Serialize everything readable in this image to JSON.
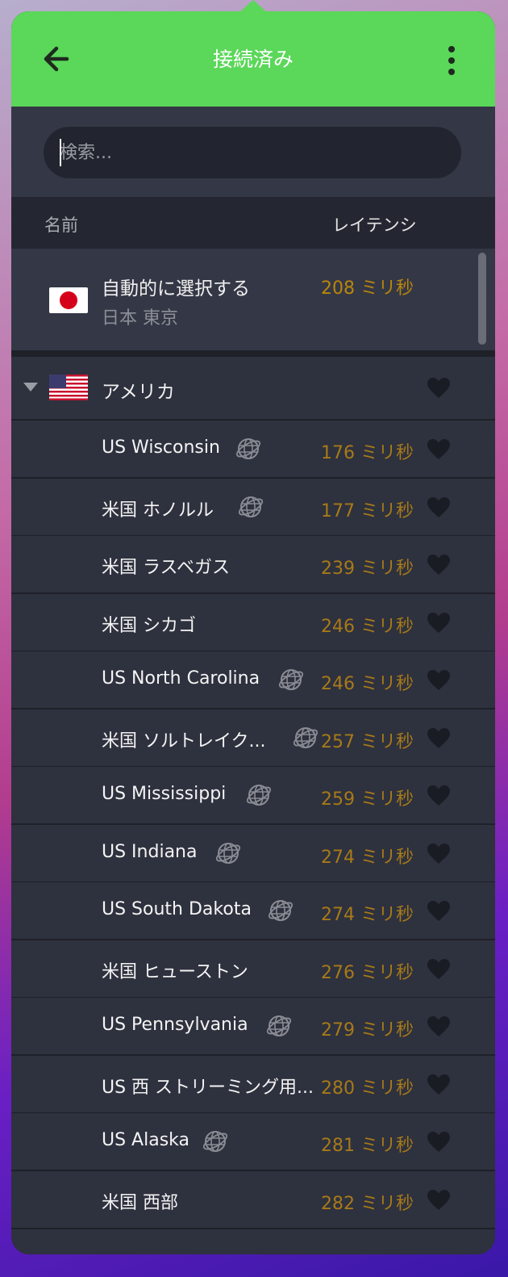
{
  "header": {
    "title": "接続済み"
  },
  "search": {
    "placeholder": "検索..."
  },
  "columns": {
    "name": "名前",
    "latency": "レイテンシ"
  },
  "auto": {
    "title": "自動的に選択する",
    "subtitle": "日本 東京",
    "latency": "208 ミリ秒"
  },
  "country": {
    "name": "アメリカ"
  },
  "servers": [
    {
      "name": "US Wisconsin",
      "latency": "176 ミリ秒"
    },
    {
      "name": "米国 ホノルル",
      "latency": "177 ミリ秒"
    },
    {
      "name": "米国 ラスベガス",
      "latency": "239 ミリ秒"
    },
    {
      "name": "米国 シカゴ",
      "latency": "246 ミリ秒"
    },
    {
      "name": "US North Carolina",
      "latency": "246 ミリ秒"
    },
    {
      "name": "米国 ソルトレイク...",
      "latency": "257 ミリ秒"
    },
    {
      "name": "US Mississippi",
      "latency": "259 ミリ秒"
    },
    {
      "name": "US Indiana",
      "latency": "274 ミリ秒"
    },
    {
      "name": "US South Dakota",
      "latency": "274 ミリ秒"
    },
    {
      "name": "米国 ヒューストン",
      "latency": "276 ミリ秒"
    },
    {
      "name": "US Pennsylvania",
      "latency": "279 ミリ秒"
    },
    {
      "name": "US 西 ストリーミング用...",
      "latency": "280 ミリ秒"
    },
    {
      "name": "US Alaska",
      "latency": "281 ミリ秒"
    },
    {
      "name": "米国 西部",
      "latency": "282 ミリ秒"
    }
  ],
  "colors": {
    "accent": "#5bd75a",
    "latency": "#a77a18",
    "panel": "#2e313e"
  }
}
